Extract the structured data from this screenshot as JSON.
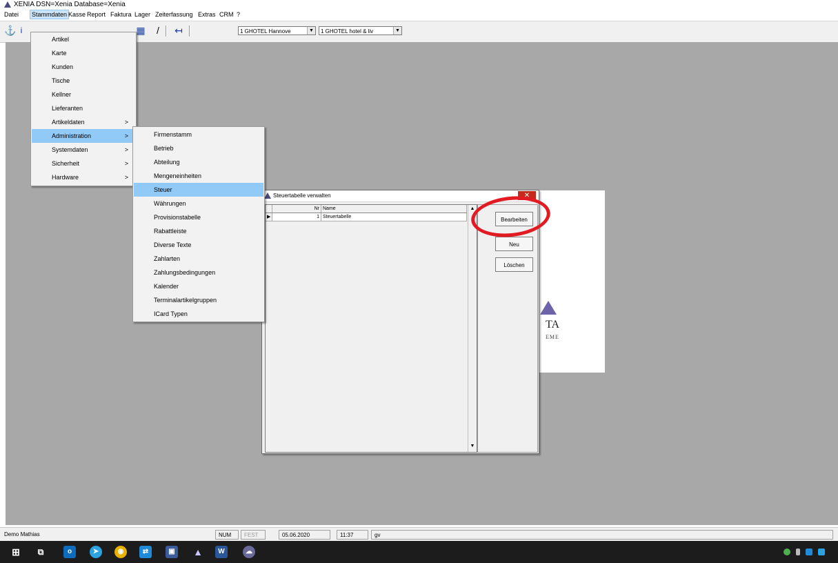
{
  "window": {
    "title": "XENIA DSN=Xenia Database=Xenia"
  },
  "menubar": {
    "items": [
      "Datei",
      "Stammdaten",
      "Kasse",
      "Report",
      "Faktura",
      "Lager",
      "Zeiterfassung",
      "Extras",
      "CRM",
      "?"
    ],
    "active": "Stammdaten"
  },
  "toolbar": {
    "icons": [
      "anchor-icon",
      "info-icon",
      "calendar-icon",
      "pencil-icon",
      "arrow-left-icon"
    ],
    "combo_hotel": "1 GHOTEL Hannove",
    "combo_hotel2": "1 GHOTEL hotel & liv"
  },
  "stammdaten_menu": {
    "items": [
      {
        "label": "Artikel",
        "submenu": false
      },
      {
        "label": "Karte",
        "submenu": false
      },
      {
        "label": "Kunden",
        "submenu": false
      },
      {
        "label": "Tische",
        "submenu": false
      },
      {
        "label": "Kellner",
        "submenu": false
      },
      {
        "label": "Lieferanten",
        "submenu": false
      },
      {
        "label": "Artikeldaten",
        "submenu": true
      },
      {
        "label": "Administration",
        "submenu": true
      },
      {
        "label": "Systemdaten",
        "submenu": true
      },
      {
        "label": "Sicherheit",
        "submenu": true
      },
      {
        "label": "Hardware",
        "submenu": true
      }
    ],
    "highlighted": "Administration",
    "submenu_arrow": ">"
  },
  "administration_menu": {
    "items": [
      "Firmenstamm",
      "Betrieb",
      "Abteilung",
      "Mengeneinheiten",
      "Steuer",
      "Währungen",
      "Provisionstabelle",
      "Rabattleiste",
      "Diverse Texte",
      "Zahlarten",
      "Zahlungsbedingungen",
      "Kalender",
      "Terminalartikelgruppen",
      "ICard Typen"
    ],
    "highlighted": "Steuer"
  },
  "dialog": {
    "title": "Steuertabelle verwalten",
    "close": "✕",
    "grid": {
      "columns": [
        "Nr",
        "Name"
      ],
      "rows": [
        {
          "nr": "1",
          "name": "Steuertabelle"
        }
      ],
      "row_marker": "▶"
    },
    "buttons": {
      "edit": "Bearbeiten",
      "new": "Neu",
      "delete": "Löschen"
    }
  },
  "logo": {
    "text": "TA",
    "subtext": "EME"
  },
  "statusbar": {
    "user": "Demo Mathias",
    "num": "NUM",
    "fest": "FEST",
    "date": "05.06.2020",
    "time": "11:37",
    "extra": "gv"
  },
  "annotation": {
    "color": "#e21b23",
    "target": "Bearbeiten"
  },
  "colors": {
    "workspace": "#a8a8a8",
    "highlight": "#91c9f7",
    "taskbar": "#1c1c1c"
  }
}
